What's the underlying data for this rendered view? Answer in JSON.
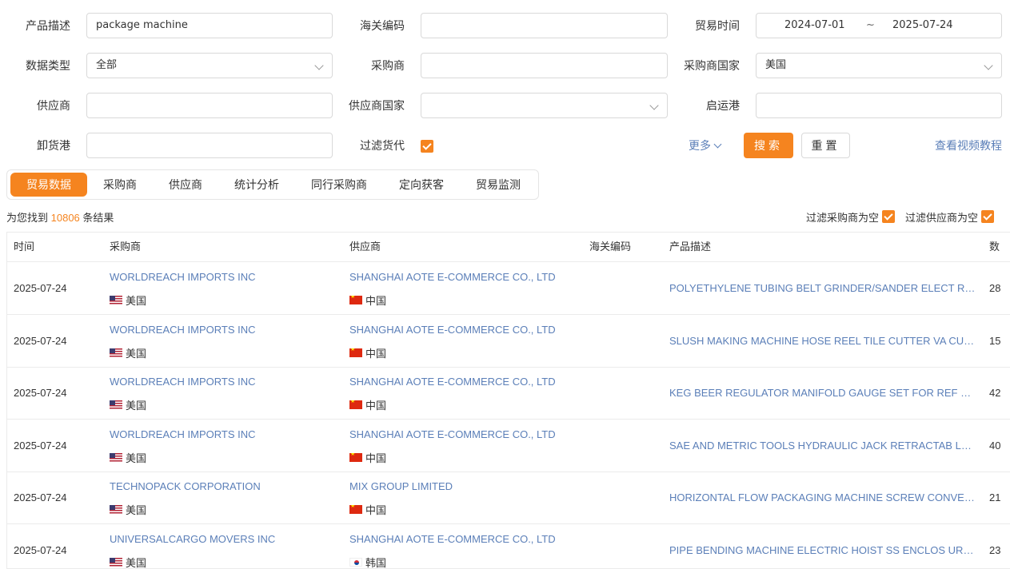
{
  "form": {
    "product_desc_label": "产品描述",
    "product_desc_value": "package machine",
    "hs_code_label": "海关编码",
    "trade_time_label": "贸易时间",
    "date_start": "2024-07-01",
    "date_sep": "~",
    "date_end": "2025-07-24",
    "data_type_label": "数据类型",
    "data_type_value": "全部",
    "buyer_label": "采购商",
    "buyer_country_label": "采购商国家",
    "buyer_country_value": "美国",
    "supplier_label": "供应商",
    "supplier_country_label": "供应商国家",
    "departure_port_label": "启运港",
    "unloading_port_label": "卸货港",
    "filter_forwarder_label": "过滤货代",
    "filter_forwarder_checked": true,
    "more_label": "更多",
    "search_label": "搜索",
    "reset_label": "重置",
    "video_tutorial_label": "查看视频教程"
  },
  "tabs": [
    {
      "label": "贸易数据",
      "active": true
    },
    {
      "label": "采购商",
      "active": false
    },
    {
      "label": "供应商",
      "active": false
    },
    {
      "label": "统计分析",
      "active": false
    },
    {
      "label": "同行采购商",
      "active": false
    },
    {
      "label": "定向获客",
      "active": false
    },
    {
      "label": "贸易监测",
      "active": false
    }
  ],
  "results": {
    "prefix": "为您找到",
    "count": "10806",
    "suffix": "条结果",
    "filter_empty_buyer": "过滤采购商为空",
    "filter_empty_supplier": "过滤供应商为空"
  },
  "table": {
    "columns": {
      "time": "时间",
      "buyer": "采购商",
      "supplier": "供应商",
      "hs_code": "海关编码",
      "product_desc": "产品描述",
      "qty": "数"
    },
    "rows": [
      {
        "date": "2025-07-24",
        "buyer": "WORLDREACH IMPORTS INC",
        "buyer_country": "美国",
        "buyer_flag": "us",
        "supplier": "SHANGHAI AOTE E-COMMERCE CO., LTD",
        "supplier_country": "中国",
        "supplier_flag": "cn",
        "desc": "POLYETHYLENE TUBING BELT GRINDER/SANDER ELECT RIC WIN...",
        "qty": "28"
      },
      {
        "date": "2025-07-24",
        "buyer": "WORLDREACH IMPORTS INC",
        "buyer_country": "美国",
        "buyer_flag": "us",
        "supplier": "SHANGHAI AOTE E-COMMERCE CO., LTD",
        "supplier_country": "中国",
        "supplier_flag": "cn",
        "desc": "SLUSH MAKING MACHINE HOSE REEL TILE CUTTER VA CUUM PU...",
        "qty": "15"
      },
      {
        "date": "2025-07-24",
        "buyer": "WORLDREACH IMPORTS INC",
        "buyer_country": "美国",
        "buyer_flag": "us",
        "supplier": "SHANGHAI AOTE E-COMMERCE CO., LTD",
        "supplier_country": "中国",
        "supplier_flag": "cn",
        "desc": "KEG BEER REGULATOR MANIFOLD GAUGE SET FOR REF RIGERAN...",
        "qty": "42"
      },
      {
        "date": "2025-07-24",
        "buyer": "WORLDREACH IMPORTS INC",
        "buyer_country": "美国",
        "buyer_flag": "us",
        "supplier": "SHANGHAI AOTE E-COMMERCE CO., LTD",
        "supplier_country": "中国",
        "supplier_flag": "cn",
        "desc": "SAE AND METRIC TOOLS HYDRAULIC JACK RETRACTAB LE EXTEN...",
        "qty": "40"
      },
      {
        "date": "2025-07-24",
        "buyer": "TECHNOPACK CORPORATION",
        "buyer_country": "美国",
        "buyer_flag": "us",
        "supplier": "MIX GROUP LIMITED",
        "supplier_country": "中国",
        "supplier_flag": "cn",
        "desc": "HORIZONTAL FLOW PACKAGING MACHINE SCREW CONVE YOR ...",
        "qty": "21"
      },
      {
        "date": "2025-07-24",
        "buyer": "UNIVERSALCARGO MOVERS INC",
        "buyer_country": "美国",
        "buyer_flag": "us",
        "supplier": "SHANGHAI AOTE E-COMMERCE CO., LTD",
        "supplier_country": "韩国",
        "supplier_flag": "kr",
        "desc": "PIPE BENDING MACHINE ELECTRIC HOIST SS ENCLOS URE SS CA...",
        "qty": "23"
      }
    ]
  }
}
